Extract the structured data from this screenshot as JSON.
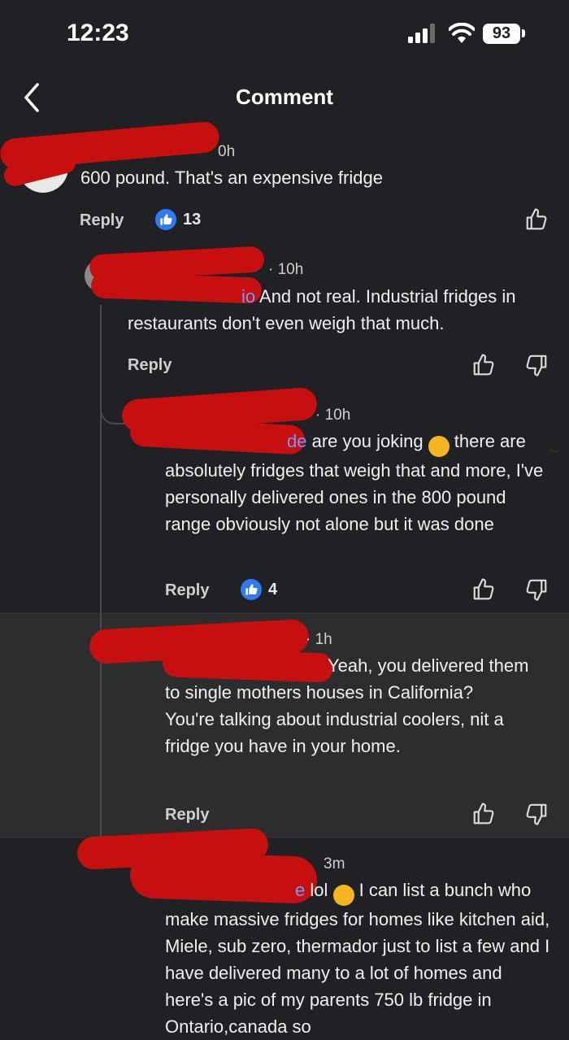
{
  "status_bar": {
    "time": "12:23",
    "battery": "93"
  },
  "header": {
    "title": "Comment"
  },
  "comments": [
    {
      "time_suffix": "0h",
      "text": "600 pound. That's an expensive fridge",
      "reply_label": "Reply",
      "likes": "13"
    },
    {
      "time_suffix": "· 10h",
      "mention_tail": "io",
      "text": " And not real. Industrial fridges in restaurants don't even weigh that much.",
      "reply_label": "Reply"
    },
    {
      "time_suffix": "· 10h",
      "mention_tail": "de",
      "text_part1": " are you joking ",
      "text_part2": " there are absolutely fridges that weigh that and more, I've personally delivered ones in the 800 pound range obviously not alone but it was done",
      "reply_label": "Reply",
      "likes": "4"
    },
    {
      "time_suffix": "· 1h",
      "text": "Yeah, you delivered them to single mothers houses in California?",
      "text2": "You're talking about industrial coolers, nit a fridge you have in your home.",
      "reply_label": "Reply"
    },
    {
      "time_suffix": "3m",
      "mention_tail": "e",
      "text_part1": " lol ",
      "text_part2": " I can list a bunch who make massive fridges for homes like kitchen aid, Miele, sub zero, thermador just to list a few and I have delivered many to a lot of homes and here's a pic of my parents 750 lb fridge in Ontario,canada so"
    }
  ],
  "icons": {
    "back": "chevron-left-icon",
    "like": "thumbs-up-icon",
    "dislike": "thumbs-down-icon",
    "emoji_upside_down": "upside-down-face-emoji",
    "emoji_laughing": "tears-of-joy-emoji"
  },
  "colors": {
    "background": "#202124",
    "highlight": "#2c2d2f",
    "mention": "#6b9cff",
    "like_badge": "#2d7cf6",
    "redaction": "#c80f0f"
  }
}
